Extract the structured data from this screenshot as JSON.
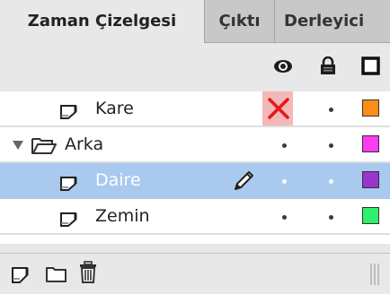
{
  "tabs": [
    {
      "label": "Zaman Çizelgesi",
      "active": true
    },
    {
      "label": "Çıktı",
      "active": false
    },
    {
      "label": "Derleyici",
      "active": false
    }
  ],
  "header_icons": {
    "visibility": "eye-icon",
    "lock": "lock-icon",
    "outline": "outline-square-icon"
  },
  "layers": [
    {
      "name": "Kare",
      "type": "layer",
      "visible": false,
      "color": "#ff8c1a",
      "selected": false
    },
    {
      "name": "Arka",
      "type": "folder",
      "expanded": true,
      "visible": true,
      "color": "#ff3cf0",
      "selected": false
    },
    {
      "name": "Daire",
      "type": "layer",
      "visible": true,
      "color": "#9a35cc",
      "selected": true,
      "editing": true
    },
    {
      "name": "Zemin",
      "type": "layer",
      "visible": true,
      "color": "#2ef06a",
      "selected": false
    }
  ],
  "bottom_icons": [
    "new-layer-icon",
    "new-folder-icon",
    "delete-icon",
    "resize-grip-icon"
  ]
}
